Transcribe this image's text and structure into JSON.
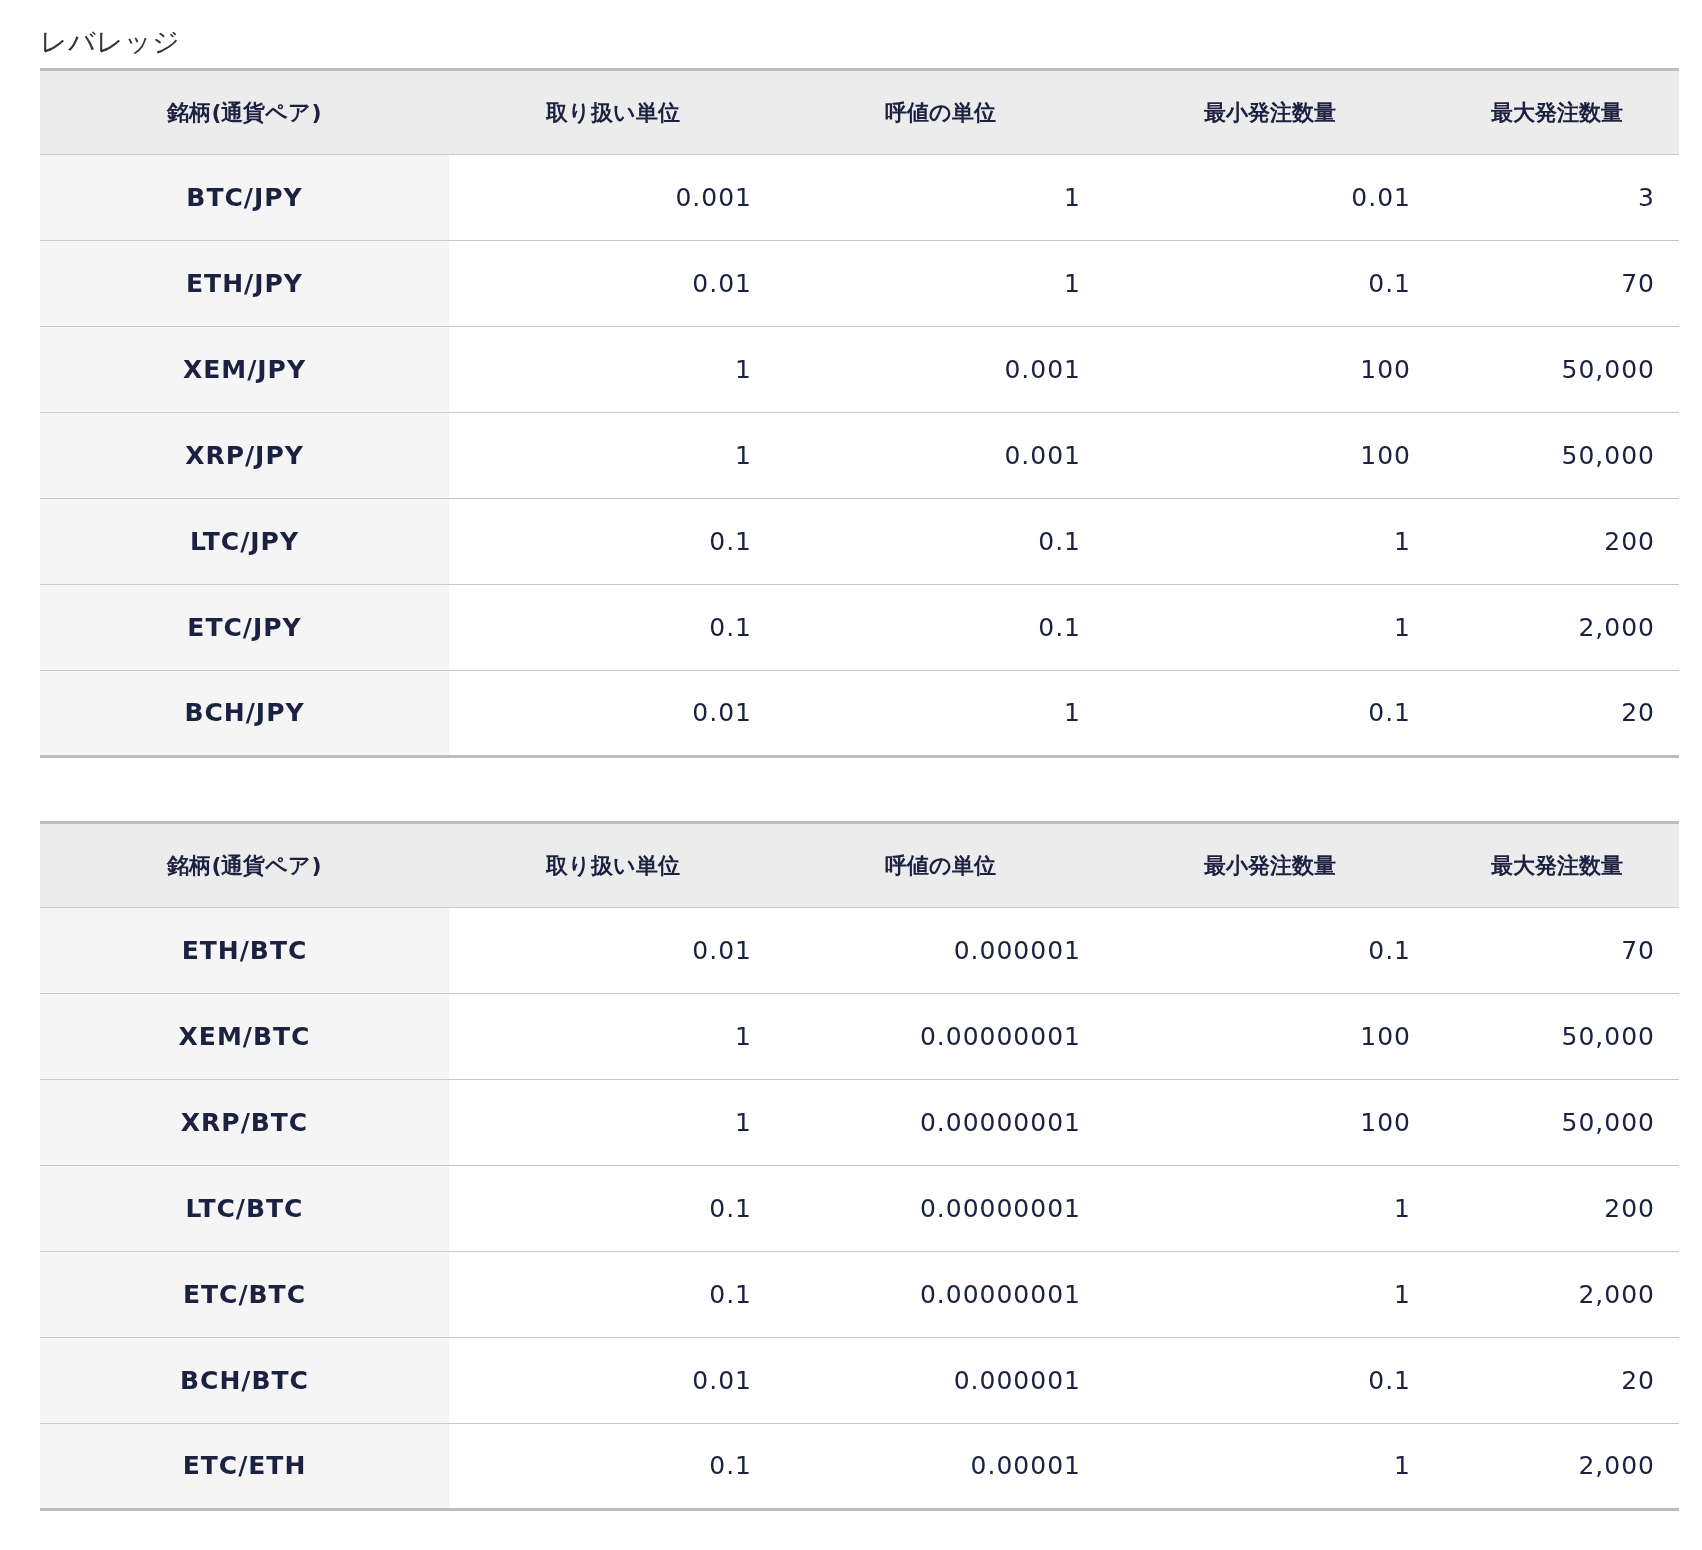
{
  "title": "レバレッジ",
  "tables": [
    {
      "columns": [
        "銘柄(通貨ペア)",
        "取り扱い単位",
        "呼値の単位",
        "最小発注数量",
        "最大発注数量"
      ],
      "rows": [
        [
          "BTC/JPY",
          "0.001",
          "1",
          "0.01",
          "3"
        ],
        [
          "ETH/JPY",
          "0.01",
          "1",
          "0.1",
          "70"
        ],
        [
          "XEM/JPY",
          "1",
          "0.001",
          "100",
          "50,000"
        ],
        [
          "XRP/JPY",
          "1",
          "0.001",
          "100",
          "50,000"
        ],
        [
          "LTC/JPY",
          "0.1",
          "0.1",
          "1",
          "200"
        ],
        [
          "ETC/JPY",
          "0.1",
          "0.1",
          "1",
          "2,000"
        ],
        [
          "BCH/JPY",
          "0.01",
          "1",
          "0.1",
          "20"
        ]
      ]
    },
    {
      "columns": [
        "銘柄(通貨ペア)",
        "取り扱い単位",
        "呼値の単位",
        "最小発注数量",
        "最大発注数量"
      ],
      "rows": [
        [
          "ETH/BTC",
          "0.01",
          "0.000001",
          "0.1",
          "70"
        ],
        [
          "XEM/BTC",
          "1",
          "0.00000001",
          "100",
          "50,000"
        ],
        [
          "XRP/BTC",
          "1",
          "0.00000001",
          "100",
          "50,000"
        ],
        [
          "LTC/BTC",
          "0.1",
          "0.00000001",
          "1",
          "200"
        ],
        [
          "ETC/BTC",
          "0.1",
          "0.00000001",
          "1",
          "2,000"
        ],
        [
          "BCH/BTC",
          "0.01",
          "0.000001",
          "0.1",
          "20"
        ],
        [
          "ETC/ETH",
          "0.1",
          "0.00001",
          "1",
          "2,000"
        ]
      ]
    }
  ]
}
